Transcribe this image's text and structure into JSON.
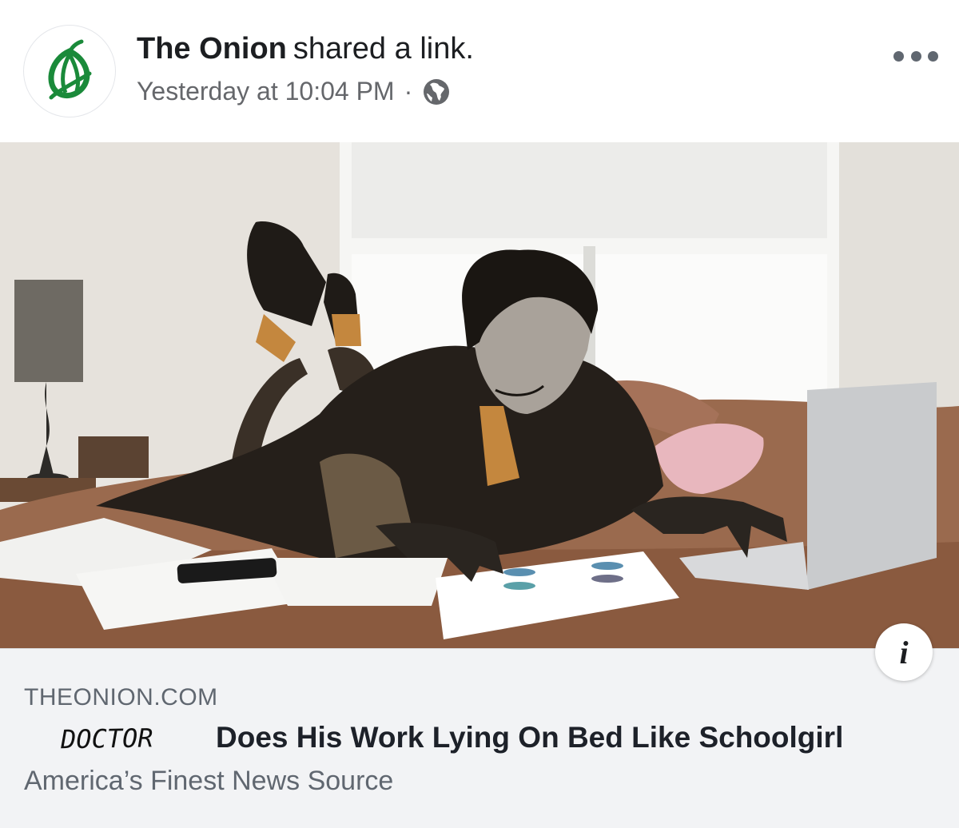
{
  "post": {
    "author": "The Onion",
    "action": "shared a link.",
    "timestamp": "Yesterday at 10:04 PM",
    "separator": "·",
    "privacy_icon": "globe-icon",
    "more_icon": "more-options-icon"
  },
  "link": {
    "domain": "THEONION.COM",
    "title_handwritten": "DOCTOR",
    "title": "Does His Work Lying On Bed Like Schoolgirl",
    "description": "America’s Finest News Source",
    "info_label": "i"
  },
  "colors": {
    "brand_green": "#1a8a3a",
    "text_primary": "#1c1e21",
    "text_secondary": "#65676b",
    "preview_bg": "#f2f3f5"
  }
}
